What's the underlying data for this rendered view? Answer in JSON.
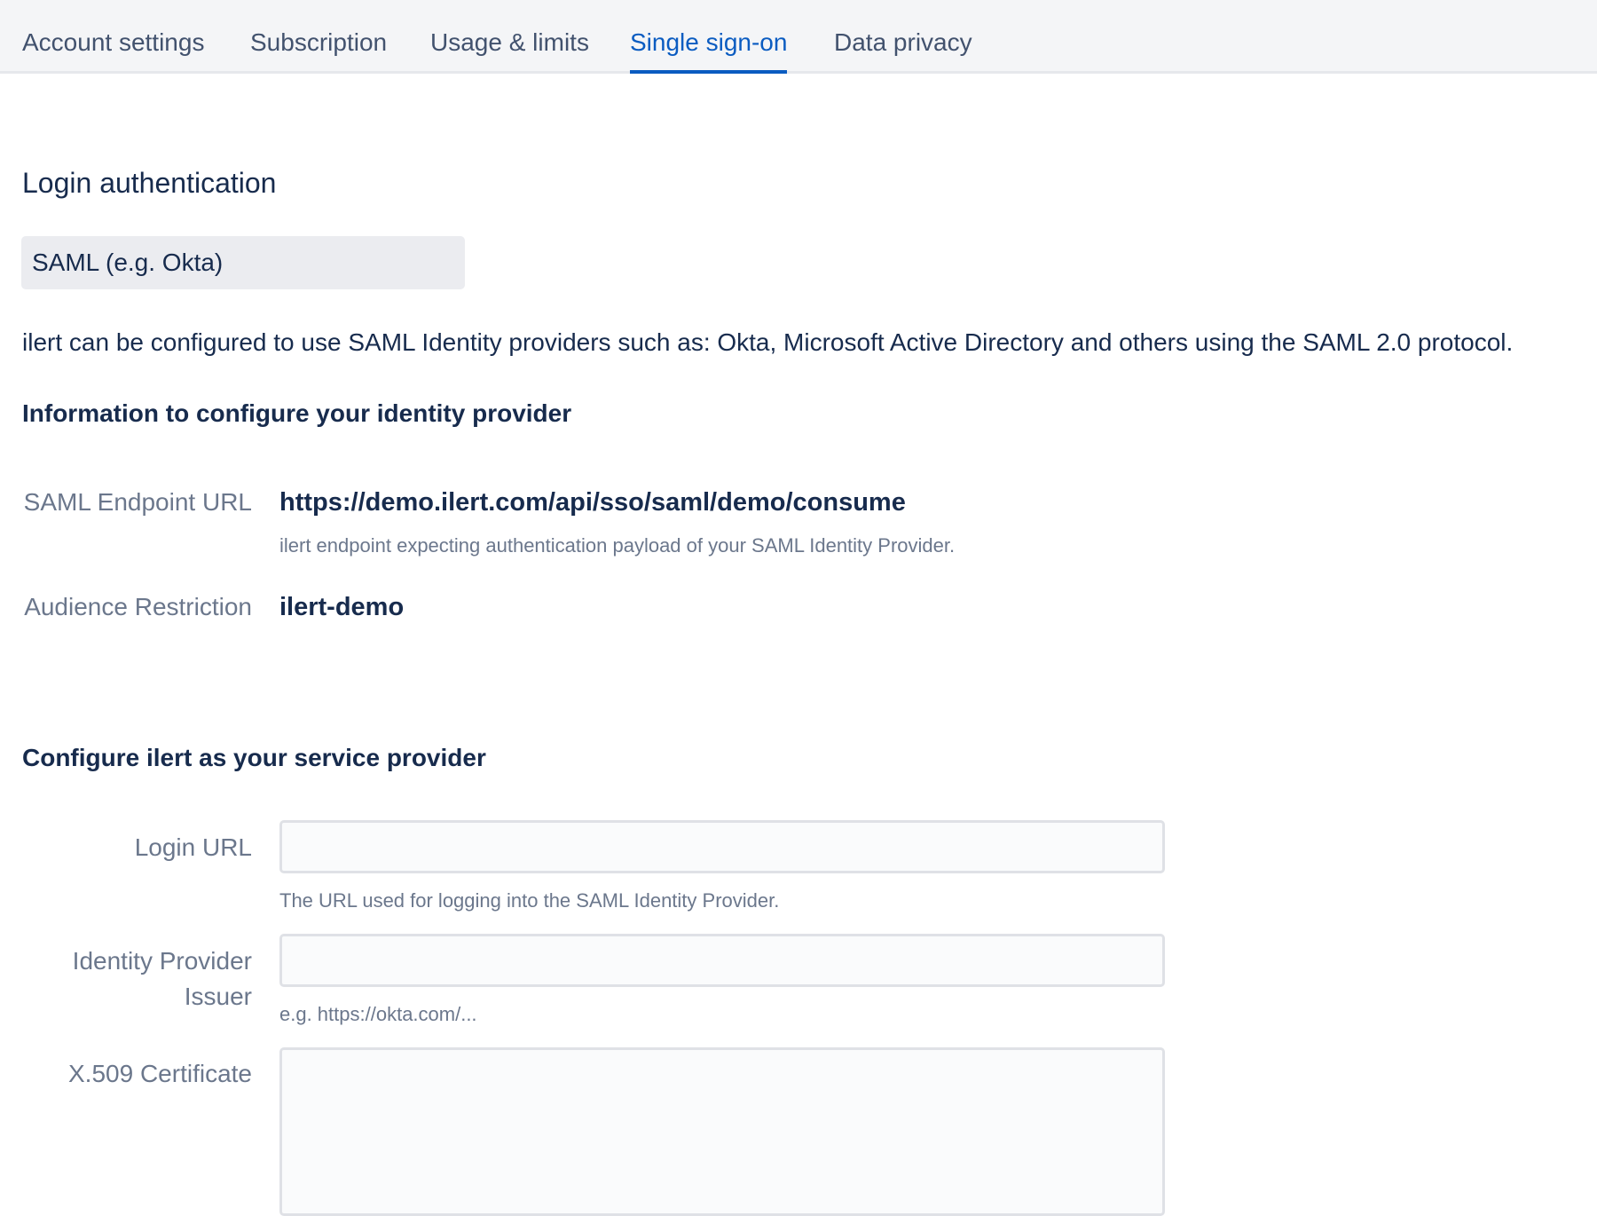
{
  "tabs": [
    {
      "label": "Account settings",
      "active": false
    },
    {
      "label": "Subscription",
      "active": false
    },
    {
      "label": "Usage & limits",
      "active": false
    },
    {
      "label": "Single sign-on",
      "active": true
    },
    {
      "label": "Data privacy",
      "active": false
    }
  ],
  "login_auth": {
    "title": "Login authentication",
    "selected_method": "SAML (e.g. Okta)",
    "description": "ilert can be configured to use SAML Identity providers such as: Okta, Microsoft Active Directory and others using the SAML 2.0 protocol."
  },
  "idp_info": {
    "title": "Information to configure your identity provider",
    "endpoint": {
      "label": "SAML Endpoint URL",
      "value": "https://demo.ilert.com/api/sso/saml/demo/consume",
      "hint": "ilert endpoint expecting authentication payload of your SAML Identity Provider."
    },
    "audience": {
      "label": "Audience Restriction",
      "value": "ilert-demo"
    }
  },
  "sp_config": {
    "title": "Configure ilert as your service provider",
    "login_url": {
      "label": "Login URL",
      "value": "",
      "hint": "The URL used for logging into the SAML Identity Provider."
    },
    "issuer": {
      "label": "Identity Provider Issuer",
      "value": "",
      "hint": "e.g. https://okta.com/..."
    },
    "certificate": {
      "label": "X.509 Certificate",
      "value": ""
    }
  },
  "colors": {
    "accent": "#0b5cc1",
    "text": "#172b4d",
    "muted": "#6b778c",
    "tabbar_bg": "#f4f5f7"
  }
}
